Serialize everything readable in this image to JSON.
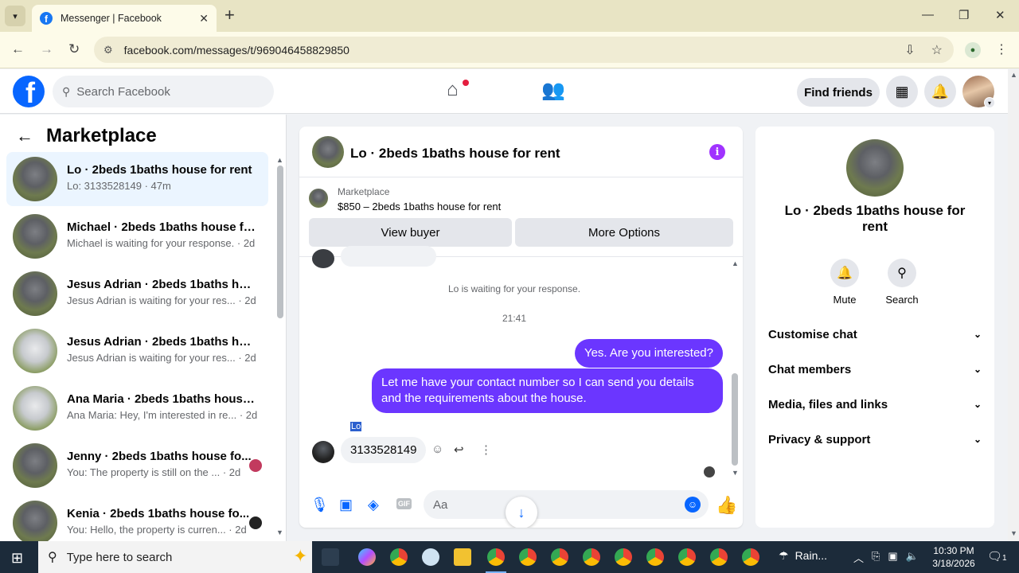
{
  "browser": {
    "tab_title": "Messenger | Facebook",
    "url": "facebook.com/messages/t/969046458829850"
  },
  "fb_nav": {
    "search_placeholder": "Search Facebook",
    "find_friends": "Find friends"
  },
  "left_panel": {
    "title": "Marketplace",
    "conversations": [
      {
        "name": "Lo · 2beds 1baths house for rent",
        "snippet": "Lo: 3133528149 · 47m",
        "active": true
      },
      {
        "name": "Michael · 2beds 1baths house fo...",
        "snippet": "Michael is waiting for your response. · 2d"
      },
      {
        "name": "Jesus Adrian · 2beds 1baths hou...",
        "snippet": "Jesus Adrian is waiting for your res... · 2d"
      },
      {
        "name": "Jesus Adrian · 2beds 1baths hou...",
        "snippet": "Jesus Adrian is waiting for your res... · 2d"
      },
      {
        "name": "Ana Maria · 2beds 1baths house ...",
        "snippet": "Ana Maria: Hey, I'm interested in re... · 2d"
      },
      {
        "name": "Jenny · 2beds 1baths house fo...",
        "snippet": "You: The property is still on the ... · 2d"
      },
      {
        "name": "Kenia · 2beds 1baths house fo...",
        "snippet": "You: Hello, the property is curren... · 2d"
      }
    ]
  },
  "chat": {
    "title": "Lo · 2beds 1baths house for rent",
    "marketplace_label": "Marketplace",
    "listing": "$850 – 2beds 1baths house for rent",
    "view_buyer": "View buyer",
    "more_options": "More Options",
    "waiting_text": "Lo is waiting for your response.",
    "timestamp": "21:41",
    "messages": {
      "out1": "Yes. Are you interested?",
      "out2_line1": "Let me have your contact number so I can send you details",
      "out2_line2": "and the requirements about the house.",
      "sender": "Lo",
      "in1": "3133528149"
    },
    "composer_placeholder": "Aa"
  },
  "right_panel": {
    "name_line1": "Lo · 2beds 1baths house for",
    "name_line2": "rent",
    "mute": "Mute",
    "search": "Search",
    "rows": [
      "Customise chat",
      "Chat members",
      "Media, files and links",
      "Privacy & support"
    ]
  },
  "taskbar": {
    "search_placeholder": "Type here to search",
    "weather": "Rain...",
    "time": "10:30 PM",
    "date": "3/18/2026",
    "notification_count": "1"
  },
  "colors": {
    "fb_blue": "#0866ff",
    "bubble_purple": "#6b36ff",
    "active_conv": "#ebf5ff"
  }
}
